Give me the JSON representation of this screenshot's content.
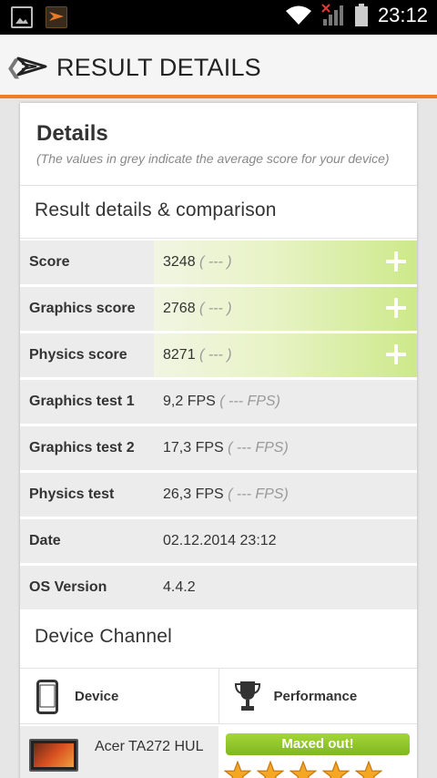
{
  "status_bar": {
    "time": "23:12",
    "icons": [
      "gallery-icon",
      "3dmark-notification-icon",
      "wifi-icon",
      "signal-icon",
      "battery-icon"
    ]
  },
  "action_bar": {
    "title": "RESULT DETAILS",
    "back_glyph": "❮"
  },
  "details": {
    "title": "Details",
    "subtitle": "(The values in grey indicate the average score for your device)"
  },
  "comparison": {
    "title": "Result details & comparison",
    "rows": [
      {
        "label": "Score",
        "value": "3248",
        "avg": "( --- )",
        "highlight": true
      },
      {
        "label": "Graphics score",
        "value": "2768",
        "avg": "( --- )",
        "highlight": true
      },
      {
        "label": "Physics score",
        "value": "8271",
        "avg": "( --- )",
        "highlight": true
      },
      {
        "label": "Graphics test 1",
        "value": "9,2 FPS",
        "avg": "( --- FPS)",
        "highlight": false
      },
      {
        "label": "Graphics test 2",
        "value": "17,3 FPS",
        "avg": "( --- FPS)",
        "highlight": false
      },
      {
        "label": "Physics test",
        "value": "26,3 FPS",
        "avg": "( --- FPS)",
        "highlight": false
      },
      {
        "label": "Date",
        "value": "02.12.2014 23:12",
        "avg": "",
        "highlight": false
      },
      {
        "label": "OS Version",
        "value": "4.4.2",
        "avg": "",
        "highlight": false
      }
    ]
  },
  "device_channel": {
    "title": "Device Channel",
    "col_device": "Device",
    "col_performance": "Performance",
    "device_name": "Acer TA272 HUL",
    "performance_badge": "Maxed out!",
    "star_rating": 5
  },
  "colors": {
    "accent": "#ef7d23",
    "highlight_green": "#cde98a",
    "badge_green": "#8cc63f",
    "star_orange": "#f5a623"
  }
}
